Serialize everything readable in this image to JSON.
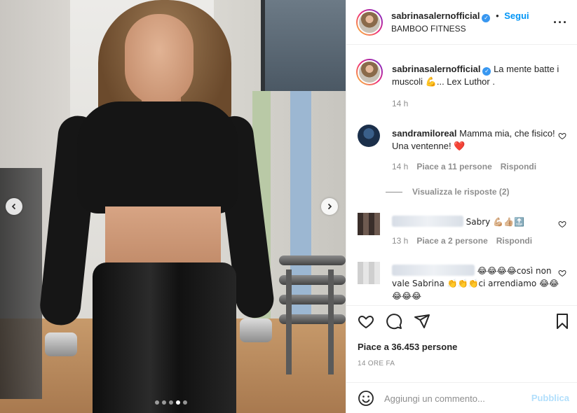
{
  "post": {
    "username": "sabrinasalernofficial",
    "follow_separator": "•",
    "follow_label": "Segui",
    "location": "BAMBOO FITNESS",
    "more_label": "···"
  },
  "caption": {
    "username": "sabrinasalernofficial",
    "text": "La mente batte i muscoli 💪... Lex Luthor .",
    "time": "14 h"
  },
  "comments": [
    {
      "username": "sandramiloreal",
      "text": "Mamma mia, che fisico! Una ventenne! ❤️",
      "time": "14 h",
      "likes": "Piace a 11 persone",
      "reply": "Rispondi",
      "view_replies": "Visualizza le risposte (2)"
    },
    {
      "username": "",
      "text": "Sabry 💪🏼👍🏼🔝",
      "time": "13 h",
      "likes": "Piace a 2 persone",
      "reply": "Rispondi"
    },
    {
      "username": "",
      "text": "😂😂😂😂così non vale Sabrina 👏👏👏ci arrendiamo 😂😂😂😂😂"
    }
  ],
  "footer": {
    "likes": "Piace a 36.453 persone",
    "time": "14 ORE FA",
    "comment_placeholder": "Aggiungi un commento...",
    "publish_label": "Pubblica"
  },
  "carousel": {
    "count": 5,
    "active_index": 3
  },
  "colors": {
    "accent": "#0095f6",
    "verified": "#3897f0",
    "muted": "#8e8e8e",
    "heart": "#ed4956"
  }
}
